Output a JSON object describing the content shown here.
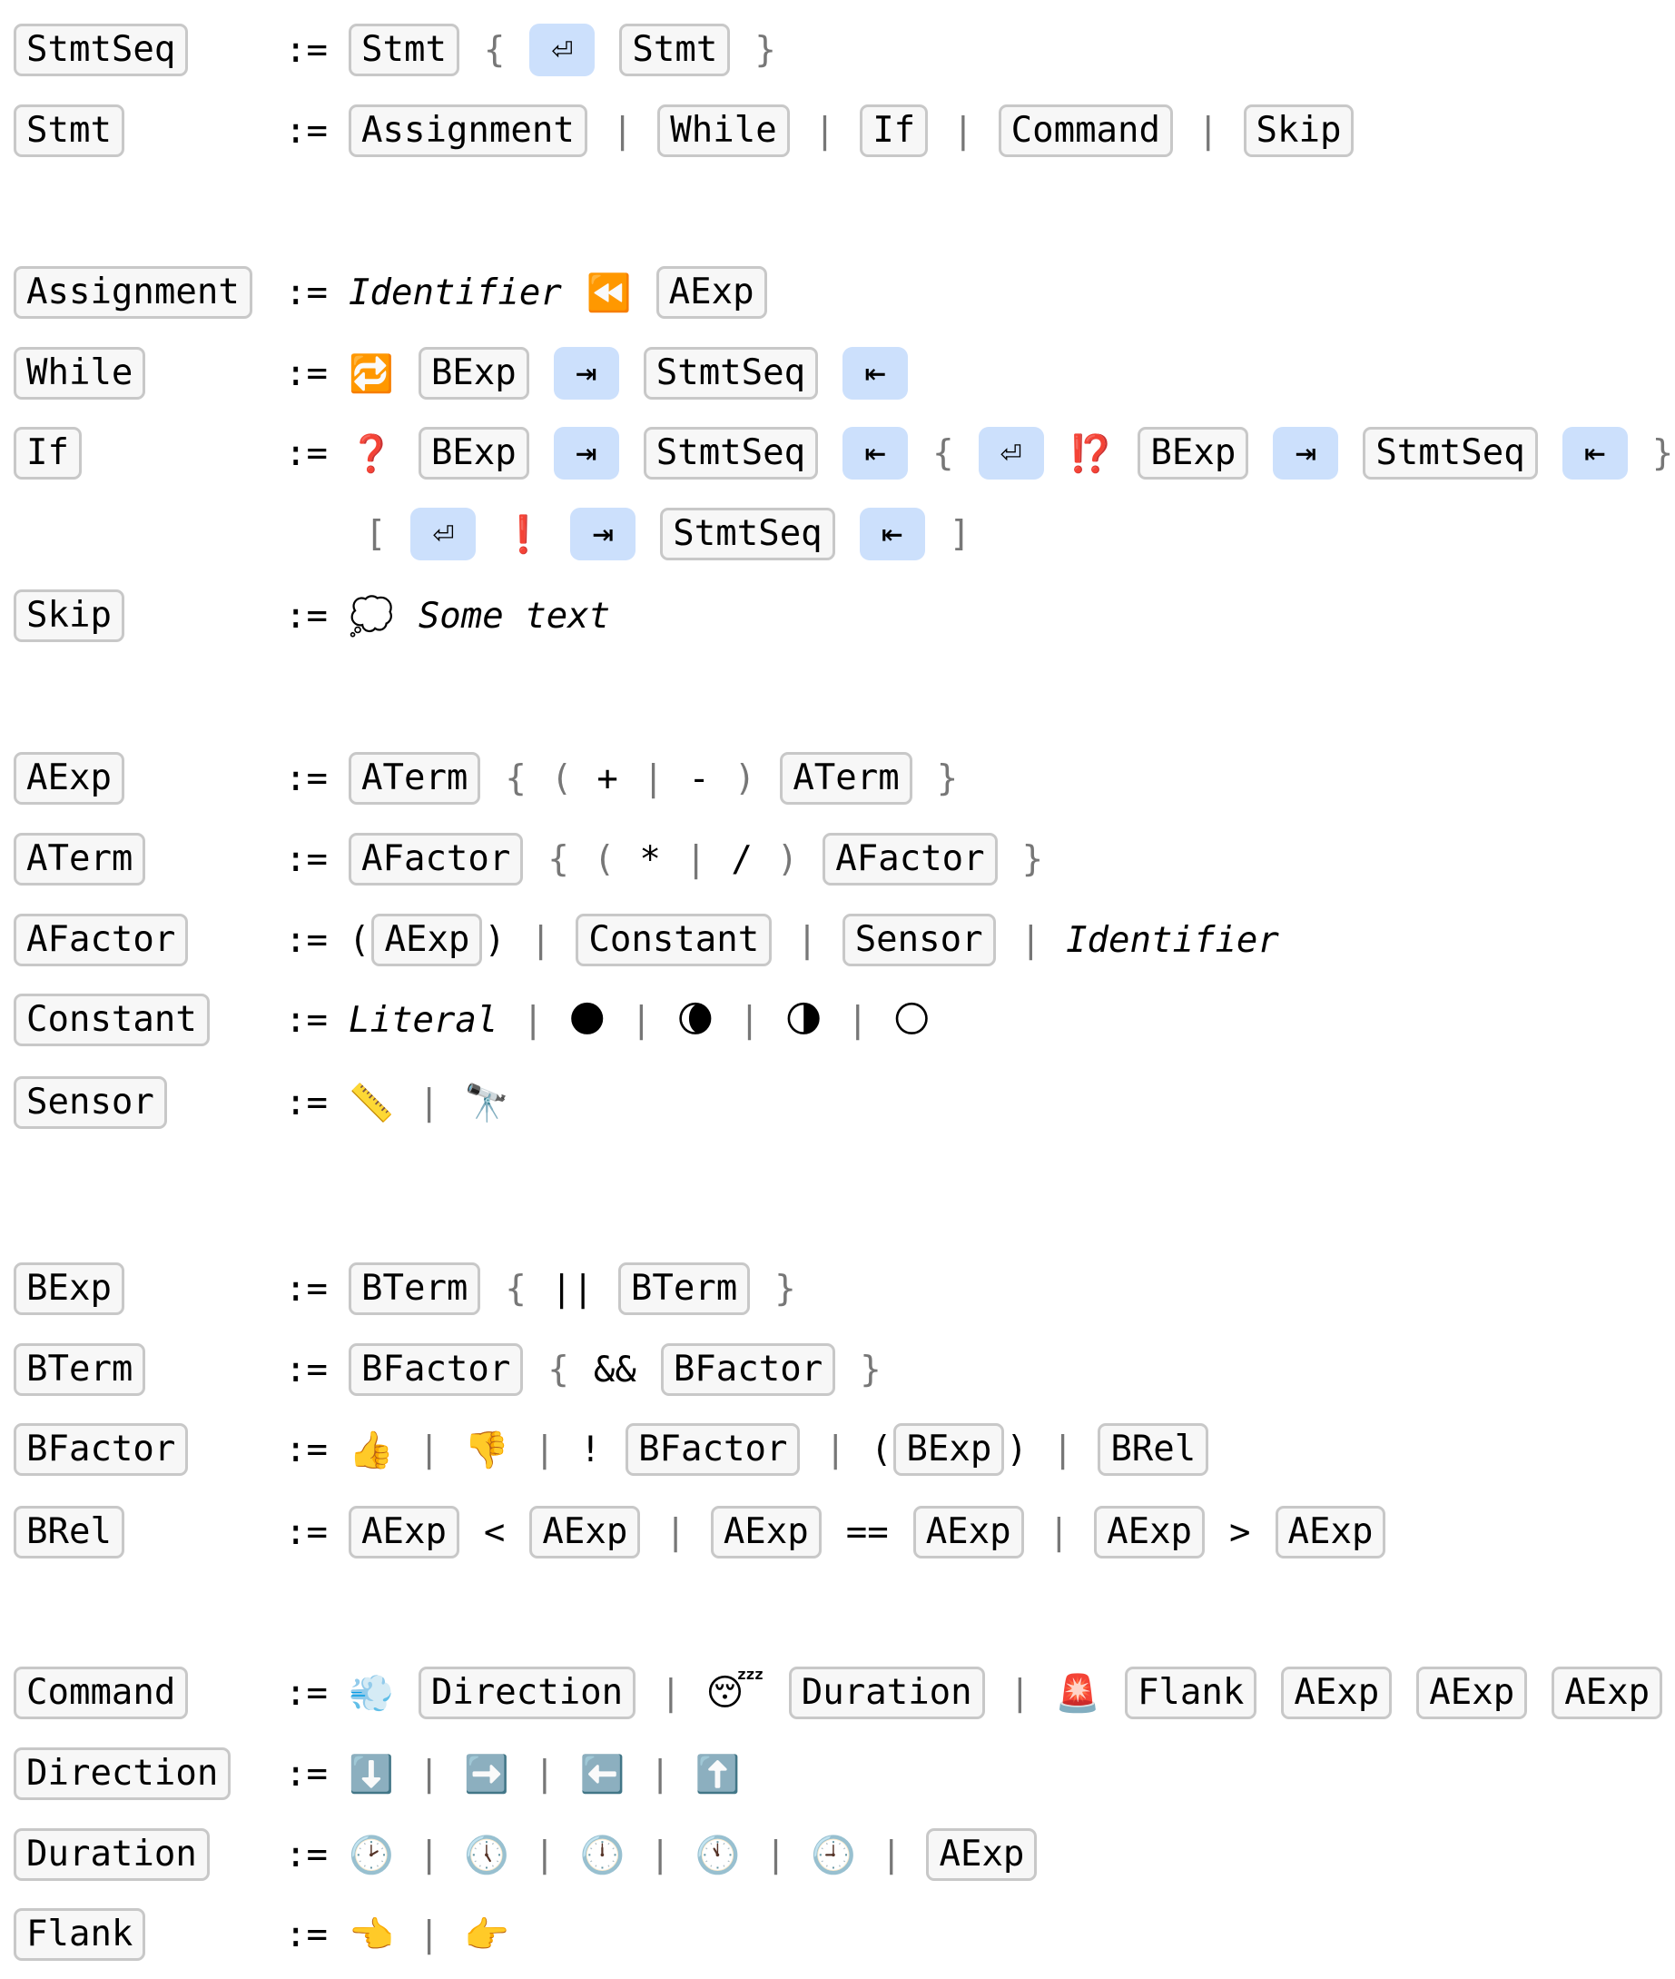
{
  "assign_symbol": ":=",
  "rules": [
    {
      "name": "StmtSeq",
      "lines": [
        [
          {
            "t": "nt",
            "v": "Stmt"
          },
          {
            "t": "sym",
            "v": "{"
          },
          {
            "t": "term",
            "v": "⏎",
            "icon": "return-icon"
          },
          {
            "t": "nt",
            "v": "Stmt"
          },
          {
            "t": "sym",
            "v": "}"
          }
        ]
      ]
    },
    {
      "name": "Stmt",
      "lines": [
        [
          {
            "t": "nt",
            "v": "Assignment"
          },
          {
            "t": "sym",
            "v": "|"
          },
          {
            "t": "nt",
            "v": "While"
          },
          {
            "t": "sym",
            "v": "|"
          },
          {
            "t": "nt",
            "v": "If"
          },
          {
            "t": "sym",
            "v": "|"
          },
          {
            "t": "nt",
            "v": "Command"
          },
          {
            "t": "sym",
            "v": "|"
          },
          {
            "t": "nt",
            "v": "Skip"
          }
        ]
      ]
    },
    {
      "name": "Assignment",
      "lines": [
        [
          {
            "t": "it",
            "v": "Identifier"
          },
          {
            "t": "emo",
            "v": "⏪",
            "icon": "rewind-icon"
          },
          {
            "t": "nt",
            "v": "AExp"
          }
        ]
      ]
    },
    {
      "name": "While",
      "lines": [
        [
          {
            "t": "emo",
            "v": "🔁",
            "icon": "repeat-icon"
          },
          {
            "t": "nt",
            "v": "BExp"
          },
          {
            "t": "term",
            "v": "⇥",
            "icon": "indent-icon"
          },
          {
            "t": "nt",
            "v": "StmtSeq"
          },
          {
            "t": "term",
            "v": "⇤",
            "icon": "dedent-icon"
          }
        ]
      ]
    },
    {
      "name": "If",
      "lines": [
        [
          {
            "t": "emo",
            "v": "❓",
            "icon": "question-icon"
          },
          {
            "t": "nt",
            "v": "BExp"
          },
          {
            "t": "term",
            "v": "⇥",
            "icon": "indent-icon"
          },
          {
            "t": "nt",
            "v": "StmtSeq"
          },
          {
            "t": "term",
            "v": "⇤",
            "icon": "dedent-icon"
          },
          {
            "t": "sym",
            "v": "{"
          },
          {
            "t": "term",
            "v": "⏎",
            "icon": "return-icon"
          },
          {
            "t": "emo",
            "v": "⁉️",
            "icon": "interrobang-icon"
          },
          {
            "t": "nt",
            "v": "BExp"
          },
          {
            "t": "term",
            "v": "⇥",
            "icon": "indent-icon"
          },
          {
            "t": "nt",
            "v": "StmtSeq"
          },
          {
            "t": "term",
            "v": "⇤",
            "icon": "dedent-icon"
          },
          {
            "t": "sym",
            "v": "}"
          }
        ],
        [
          {
            "t": "sym",
            "v": "["
          },
          {
            "t": "term",
            "v": "⏎",
            "icon": "return-icon"
          },
          {
            "t": "emo",
            "v": "❗",
            "icon": "exclamation-icon"
          },
          {
            "t": "term",
            "v": "⇥",
            "icon": "indent-icon"
          },
          {
            "t": "nt",
            "v": "StmtSeq"
          },
          {
            "t": "term",
            "v": "⇤",
            "icon": "dedent-icon"
          },
          {
            "t": "sym",
            "v": "]"
          }
        ]
      ]
    },
    {
      "name": "Skip",
      "lines": [
        [
          {
            "t": "emo",
            "v": "💭",
            "icon": "thought-bubble-icon"
          },
          {
            "t": "it",
            "v": "Some text"
          }
        ]
      ]
    },
    {
      "name": "AExp",
      "lines": [
        [
          {
            "t": "nt",
            "v": "ATerm"
          },
          {
            "t": "sym",
            "v": "{"
          },
          {
            "t": "sym",
            "v": "("
          },
          {
            "t": "op",
            "v": "+"
          },
          {
            "t": "sym",
            "v": "|"
          },
          {
            "t": "op",
            "v": "-"
          },
          {
            "t": "sym",
            "v": ")"
          },
          {
            "t": "nt",
            "v": "ATerm"
          },
          {
            "t": "sym",
            "v": "}"
          }
        ]
      ]
    },
    {
      "name": "ATerm",
      "lines": [
        [
          {
            "t": "nt",
            "v": "AFactor"
          },
          {
            "t": "sym",
            "v": "{"
          },
          {
            "t": "sym",
            "v": "("
          },
          {
            "t": "op",
            "v": "*"
          },
          {
            "t": "sym",
            "v": "|"
          },
          {
            "t": "op",
            "v": "/"
          },
          {
            "t": "sym",
            "v": ")"
          },
          {
            "t": "nt",
            "v": "AFactor"
          },
          {
            "t": "sym",
            "v": "}"
          }
        ]
      ]
    },
    {
      "name": "AFactor",
      "lines": [
        [
          {
            "t": "paren",
            "v": "AExp"
          },
          {
            "t": "sym",
            "v": "|"
          },
          {
            "t": "nt",
            "v": "Constant"
          },
          {
            "t": "sym",
            "v": "|"
          },
          {
            "t": "nt",
            "v": "Sensor"
          },
          {
            "t": "sym",
            "v": "|"
          },
          {
            "t": "it",
            "v": "Identifier"
          }
        ]
      ]
    },
    {
      "name": "Constant",
      "lines": [
        [
          {
            "t": "it",
            "v": "Literal"
          },
          {
            "t": "sym",
            "v": "|"
          },
          {
            "t": "emo",
            "v": "🌑",
            "icon": "new-moon-icon"
          },
          {
            "t": "sym",
            "v": "|"
          },
          {
            "t": "emo",
            "v": "🌘",
            "icon": "crescent-moon-icon"
          },
          {
            "t": "sym",
            "v": "|"
          },
          {
            "t": "emo",
            "v": "🌗",
            "icon": "half-moon-icon"
          },
          {
            "t": "sym",
            "v": "|"
          },
          {
            "t": "emo",
            "v": "🌕",
            "icon": "full-moon-icon"
          }
        ]
      ]
    },
    {
      "name": "Sensor",
      "lines": [
        [
          {
            "t": "emo",
            "v": "📏",
            "icon": "ruler-icon"
          },
          {
            "t": "sym",
            "v": "|"
          },
          {
            "t": "emo",
            "v": "🔭",
            "icon": "telescope-icon"
          }
        ]
      ]
    },
    {
      "name": "BExp",
      "lines": [
        [
          {
            "t": "nt",
            "v": "BTerm"
          },
          {
            "t": "sym",
            "v": "{"
          },
          {
            "t": "op",
            "v": "||"
          },
          {
            "t": "nt",
            "v": "BTerm"
          },
          {
            "t": "sym",
            "v": "}"
          }
        ]
      ]
    },
    {
      "name": "BTerm",
      "lines": [
        [
          {
            "t": "nt",
            "v": "BFactor"
          },
          {
            "t": "sym",
            "v": "{"
          },
          {
            "t": "op",
            "v": "&&"
          },
          {
            "t": "nt",
            "v": "BFactor"
          },
          {
            "t": "sym",
            "v": "}"
          }
        ]
      ]
    },
    {
      "name": "BFactor",
      "lines": [
        [
          {
            "t": "emo",
            "v": "👍",
            "icon": "thumbs-up-icon"
          },
          {
            "t": "sym",
            "v": "|"
          },
          {
            "t": "emo",
            "v": "👎",
            "icon": "thumbs-down-icon"
          },
          {
            "t": "sym",
            "v": "|"
          },
          {
            "t": "op",
            "v": "!"
          },
          {
            "t": "nt",
            "v": "BFactor"
          },
          {
            "t": "sym",
            "v": "|"
          },
          {
            "t": "paren",
            "v": "BExp"
          },
          {
            "t": "sym",
            "v": "|"
          },
          {
            "t": "nt",
            "v": "BRel"
          }
        ]
      ]
    },
    {
      "name": "BRel",
      "lines": [
        [
          {
            "t": "nt",
            "v": "AExp"
          },
          {
            "t": "op",
            "v": "<"
          },
          {
            "t": "nt",
            "v": "AExp"
          },
          {
            "t": "sym",
            "v": "|"
          },
          {
            "t": "nt",
            "v": "AExp"
          },
          {
            "t": "op",
            "v": "=="
          },
          {
            "t": "nt",
            "v": "AExp"
          },
          {
            "t": "sym",
            "v": "|"
          },
          {
            "t": "nt",
            "v": "AExp"
          },
          {
            "t": "op",
            "v": ">"
          },
          {
            "t": "nt",
            "v": "AExp"
          }
        ]
      ]
    },
    {
      "name": "Command",
      "lines": [
        [
          {
            "t": "emo",
            "v": "💨",
            "icon": "wind-icon"
          },
          {
            "t": "nt",
            "v": "Direction"
          },
          {
            "t": "sym",
            "v": "|"
          },
          {
            "t": "emo",
            "v": "😴",
            "icon": "sleeping-face-icon"
          },
          {
            "t": "nt",
            "v": "Duration"
          },
          {
            "t": "sym",
            "v": "|"
          },
          {
            "t": "emo",
            "v": "🚨",
            "icon": "siren-icon"
          },
          {
            "t": "nt",
            "v": "Flank"
          },
          {
            "t": "nt",
            "v": "AExp"
          },
          {
            "t": "nt",
            "v": "AExp"
          },
          {
            "t": "nt",
            "v": "AExp"
          }
        ]
      ]
    },
    {
      "name": "Direction",
      "lines": [
        [
          {
            "t": "emo",
            "v": "⬇️",
            "icon": "arrow-down-icon"
          },
          {
            "t": "sym",
            "v": "|"
          },
          {
            "t": "emo",
            "v": "➡️",
            "icon": "arrow-right-icon"
          },
          {
            "t": "sym",
            "v": "|"
          },
          {
            "t": "emo",
            "v": "⬅️",
            "icon": "arrow-left-icon"
          },
          {
            "t": "sym",
            "v": "|"
          },
          {
            "t": "emo",
            "v": "⬆️",
            "icon": "arrow-up-icon"
          }
        ]
      ]
    },
    {
      "name": "Duration",
      "lines": [
        [
          {
            "t": "emo",
            "v": "🕑",
            "icon": "clock-icon"
          },
          {
            "t": "sym",
            "v": "|"
          },
          {
            "t": "emo",
            "v": "🕔",
            "icon": "clock-icon"
          },
          {
            "t": "sym",
            "v": "|"
          },
          {
            "t": "emo",
            "v": "🕛",
            "icon": "clock-icon"
          },
          {
            "t": "sym",
            "v": "|"
          },
          {
            "t": "emo",
            "v": "🕚",
            "icon": "clock-icon"
          },
          {
            "t": "sym",
            "v": "|"
          },
          {
            "t": "emo",
            "v": "🕘",
            "icon": "clock-icon"
          },
          {
            "t": "sym",
            "v": "|"
          },
          {
            "t": "nt",
            "v": "AExp"
          }
        ]
      ]
    },
    {
      "name": "Flank",
      "lines": [
        [
          {
            "t": "emo",
            "v": "👈",
            "icon": "point-left-icon"
          },
          {
            "t": "sym",
            "v": "|"
          },
          {
            "t": "emo",
            "v": "👉",
            "icon": "point-right-icon"
          }
        ]
      ]
    }
  ]
}
